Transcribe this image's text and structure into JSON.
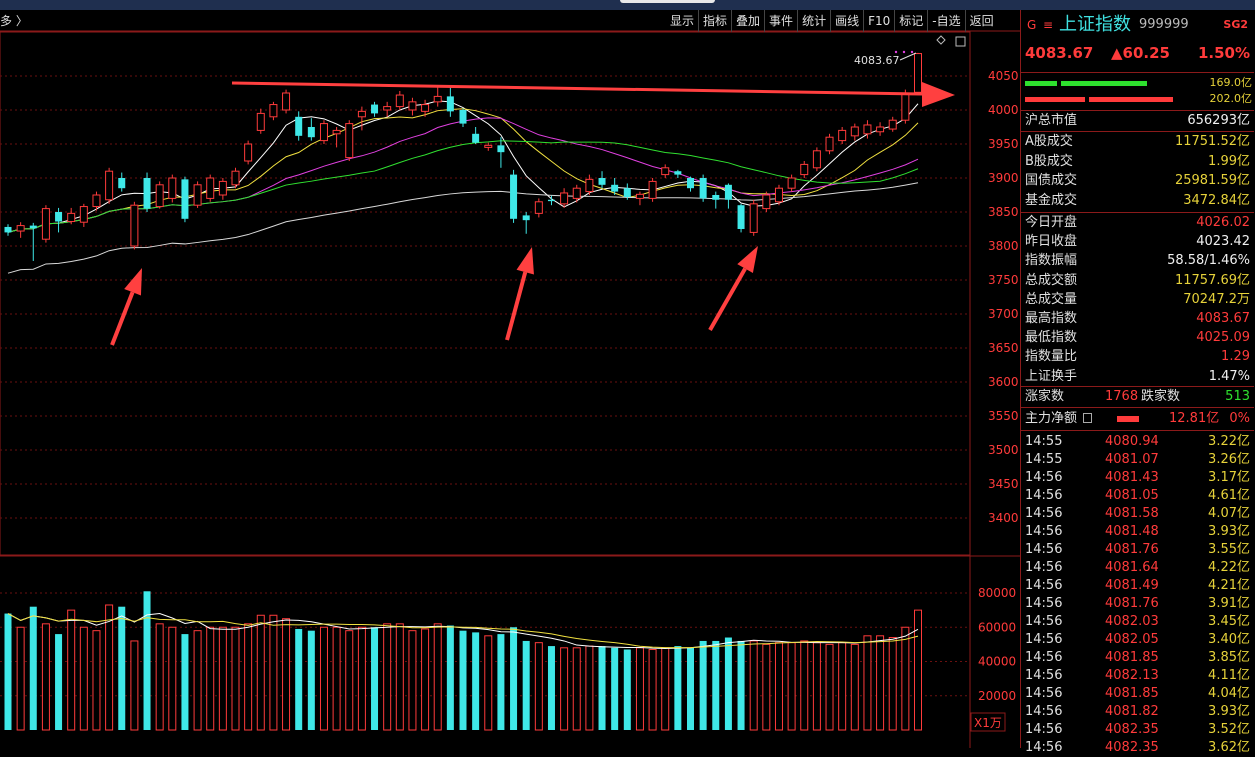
{
  "crumb": "多 〉",
  "toolbar": [
    "显示",
    "指标",
    "叠加",
    "事件",
    "统计",
    "画线",
    "F10",
    "标记",
    "-自选",
    "返回"
  ],
  "chart_data": {
    "type": "candlestick",
    "price_axis": {
      "range": [
        3360,
        4090
      ],
      "ticks": [
        4050,
        4000,
        3950,
        3900,
        3850,
        3800,
        3750,
        3700,
        3650,
        3600,
        3550,
        3500,
        3450,
        3400
      ]
    },
    "volume_axis": {
      "range": [
        0,
        90000
      ],
      "ticks": [
        80000,
        60000,
        40000,
        20000
      ],
      "unit": "X1万"
    },
    "last_label": "4083.67",
    "candles": [
      {
        "o": 3828,
        "h": 3832,
        "l": 3815,
        "c": 3820
      },
      {
        "o": 3822,
        "h": 3835,
        "l": 3812,
        "c": 3830
      },
      {
        "o": 3830,
        "h": 3834,
        "l": 3778,
        "c": 3826
      },
      {
        "o": 3810,
        "h": 3860,
        "l": 3805,
        "c": 3855
      },
      {
        "o": 3850,
        "h": 3856,
        "l": 3820,
        "c": 3836
      },
      {
        "o": 3836,
        "h": 3856,
        "l": 3832,
        "c": 3848
      },
      {
        "o": 3835,
        "h": 3862,
        "l": 3828,
        "c": 3858
      },
      {
        "o": 3858,
        "h": 3880,
        "l": 3852,
        "c": 3875
      },
      {
        "o": 3868,
        "h": 3915,
        "l": 3862,
        "c": 3910
      },
      {
        "o": 3900,
        "h": 3908,
        "l": 3880,
        "c": 3885
      },
      {
        "o": 3800,
        "h": 3865,
        "l": 3795,
        "c": 3860
      },
      {
        "o": 3900,
        "h": 3908,
        "l": 3850,
        "c": 3855
      },
      {
        "o": 3858,
        "h": 3895,
        "l": 3855,
        "c": 3890
      },
      {
        "o": 3870,
        "h": 3905,
        "l": 3864,
        "c": 3900
      },
      {
        "o": 3898,
        "h": 3902,
        "l": 3835,
        "c": 3840
      },
      {
        "o": 3860,
        "h": 3895,
        "l": 3856,
        "c": 3890
      },
      {
        "o": 3870,
        "h": 3905,
        "l": 3865,
        "c": 3900
      },
      {
        "o": 3875,
        "h": 3900,
        "l": 3868,
        "c": 3895
      },
      {
        "o": 3890,
        "h": 3915,
        "l": 3885,
        "c": 3910
      },
      {
        "o": 3925,
        "h": 3955,
        "l": 3920,
        "c": 3950
      },
      {
        "o": 3970,
        "h": 4002,
        "l": 3965,
        "c": 3995
      },
      {
        "o": 3990,
        "h": 4012,
        "l": 3985,
        "c": 4008
      },
      {
        "o": 4000,
        "h": 4030,
        "l": 3995,
        "c": 4025
      },
      {
        "o": 3990,
        "h": 3998,
        "l": 3955,
        "c": 3962
      },
      {
        "o": 3975,
        "h": 3988,
        "l": 3955,
        "c": 3960
      },
      {
        "o": 3955,
        "h": 3985,
        "l": 3950,
        "c": 3980
      },
      {
        "o": 3965,
        "h": 3975,
        "l": 3945,
        "c": 3970
      },
      {
        "o": 3930,
        "h": 3985,
        "l": 3925,
        "c": 3980
      },
      {
        "o": 3990,
        "h": 4005,
        "l": 3970,
        "c": 3998
      },
      {
        "o": 4008,
        "h": 4012,
        "l": 3990,
        "c": 3995
      },
      {
        "o": 4000,
        "h": 4012,
        "l": 3990,
        "c": 4005
      },
      {
        "o": 4005,
        "h": 4028,
        "l": 4000,
        "c": 4022
      },
      {
        "o": 4000,
        "h": 4018,
        "l": 3992,
        "c": 4012
      },
      {
        "o": 3998,
        "h": 4015,
        "l": 3990,
        "c": 4008
      },
      {
        "o": 4012,
        "h": 4035,
        "l": 4005,
        "c": 4020
      },
      {
        "o": 4020,
        "h": 4035,
        "l": 3990,
        "c": 3998
      },
      {
        "o": 4000,
        "h": 4002,
        "l": 3975,
        "c": 3980
      },
      {
        "o": 3965,
        "h": 3975,
        "l": 3950,
        "c": 3952
      },
      {
        "o": 3945,
        "h": 3952,
        "l": 3940,
        "c": 3948
      },
      {
        "o": 3948,
        "h": 3960,
        "l": 3915,
        "c": 3938
      },
      {
        "o": 3905,
        "h": 3912,
        "l": 3834,
        "c": 3840
      },
      {
        "o": 3845,
        "h": 3850,
        "l": 3818,
        "c": 3838
      },
      {
        "o": 3848,
        "h": 3870,
        "l": 3842,
        "c": 3865
      },
      {
        "o": 3868,
        "h": 3874,
        "l": 3860,
        "c": 3866
      },
      {
        "o": 3862,
        "h": 3885,
        "l": 3856,
        "c": 3878
      },
      {
        "o": 3870,
        "h": 3890,
        "l": 3864,
        "c": 3885
      },
      {
        "o": 3880,
        "h": 3905,
        "l": 3875,
        "c": 3898
      },
      {
        "o": 3900,
        "h": 3910,
        "l": 3885,
        "c": 3890
      },
      {
        "o": 3890,
        "h": 3900,
        "l": 3875,
        "c": 3880
      },
      {
        "o": 3885,
        "h": 3892,
        "l": 3868,
        "c": 3872
      },
      {
        "o": 3870,
        "h": 3880,
        "l": 3860,
        "c": 3876
      },
      {
        "o": 3870,
        "h": 3900,
        "l": 3865,
        "c": 3895
      },
      {
        "o": 3905,
        "h": 3920,
        "l": 3900,
        "c": 3915
      },
      {
        "o": 3910,
        "h": 3912,
        "l": 3900,
        "c": 3905
      },
      {
        "o": 3900,
        "h": 3902,
        "l": 3880,
        "c": 3885
      },
      {
        "o": 3900,
        "h": 3905,
        "l": 3865,
        "c": 3870
      },
      {
        "o": 3875,
        "h": 3880,
        "l": 3855,
        "c": 3868
      },
      {
        "o": 3890,
        "h": 3892,
        "l": 3855,
        "c": 3868
      },
      {
        "o": 3860,
        "h": 3862,
        "l": 3820,
        "c": 3825
      },
      {
        "o": 3820,
        "h": 3868,
        "l": 3815,
        "c": 3862
      },
      {
        "o": 3855,
        "h": 3880,
        "l": 3850,
        "c": 3875
      },
      {
        "o": 3865,
        "h": 3890,
        "l": 3860,
        "c": 3885
      },
      {
        "o": 3885,
        "h": 3905,
        "l": 3880,
        "c": 3900
      },
      {
        "o": 3905,
        "h": 3925,
        "l": 3900,
        "c": 3920
      },
      {
        "o": 3915,
        "h": 3945,
        "l": 3910,
        "c": 3940
      },
      {
        "o": 3940,
        "h": 3965,
        "l": 3935,
        "c": 3960
      },
      {
        "o": 3955,
        "h": 3975,
        "l": 3950,
        "c": 3970
      },
      {
        "o": 3962,
        "h": 3980,
        "l": 3955,
        "c": 3975
      },
      {
        "o": 3965,
        "h": 3985,
        "l": 3958,
        "c": 3978
      },
      {
        "o": 3968,
        "h": 3982,
        "l": 3962,
        "c": 3975
      },
      {
        "o": 3972,
        "h": 3990,
        "l": 3968,
        "c": 3985
      },
      {
        "o": 3985,
        "h": 4030,
        "l": 3980,
        "c": 4025
      },
      {
        "o": 4026,
        "h": 4084,
        "l": 4025,
        "c": 4083
      }
    ],
    "volumes": [
      68000,
      60000,
      72000,
      62000,
      56000,
      70000,
      60000,
      58000,
      73000,
      72000,
      52000,
      81000,
      62000,
      60000,
      56000,
      58000,
      60000,
      60000,
      60000,
      62000,
      67000,
      67000,
      65000,
      59000,
      58000,
      60000,
      60000,
      58000,
      60000,
      60000,
      62000,
      62000,
      58000,
      59000,
      62000,
      61000,
      58000,
      57000,
      55000,
      56000,
      60000,
      52000,
      51000,
      49000,
      48000,
      48000,
      49000,
      49000,
      48000,
      47000,
      48000,
      47000,
      48000,
      49000,
      48000,
      52000,
      52000,
      54000,
      52000,
      52000,
      50000,
      51000,
      51000,
      52000,
      51000,
      50000,
      51000,
      50000,
      55000,
      55000,
      54000,
      60000,
      70000
    ]
  },
  "sidebar": {
    "g": "G",
    "menu": "≡",
    "name": "上证指数",
    "code": "999999",
    "sg": "SG2",
    "price": "4083.67",
    "change": "▲60.25",
    "pct": "1.50%",
    "bar1": "169.0亿",
    "bar2": "202.0亿",
    "market_cap_label": "沪总市值",
    "market_cap": "656293亿",
    "stats1": [
      {
        "label": "A股成交",
        "value": "11751.52亿"
      },
      {
        "label": "B股成交",
        "value": "1.99亿"
      },
      {
        "label": "国债成交",
        "value": "25981.59亿"
      },
      {
        "label": "基金成交",
        "value": "3472.84亿"
      }
    ],
    "stats2": [
      {
        "label": "今日开盘",
        "value": "4026.02",
        "color": "red"
      },
      {
        "label": "昨日收盘",
        "value": "4023.42",
        "color": "wht"
      },
      {
        "label": "指数振幅",
        "value": "58.58/1.46%",
        "color": "wht"
      },
      {
        "label": "总成交额",
        "value": "11757.69亿",
        "color": "yel"
      },
      {
        "label": "总成交量",
        "value": "70247.2万",
        "color": "yel"
      },
      {
        "label": "最高指数",
        "value": "4083.67",
        "color": "red"
      },
      {
        "label": "最低指数",
        "value": "4025.09",
        "color": "red"
      },
      {
        "label": "指数量比",
        "value": "1.29",
        "color": "red"
      },
      {
        "label": "上证换手",
        "value": "1.47%",
        "color": "wht"
      }
    ],
    "rise_label": "涨家数",
    "rise": "1768",
    "fall_label": "跌家数",
    "fall": "513",
    "net_label": "主力净额",
    "net": "12.81亿",
    "net_pct": "0%",
    "ticks": [
      {
        "t": "14:55",
        "p": "4080.94",
        "v": "3.22亿"
      },
      {
        "t": "14:55",
        "p": "4081.07",
        "v": "3.26亿"
      },
      {
        "t": "14:56",
        "p": "4081.43",
        "v": "3.17亿"
      },
      {
        "t": "14:56",
        "p": "4081.05",
        "v": "4.61亿"
      },
      {
        "t": "14:56",
        "p": "4081.58",
        "v": "4.07亿"
      },
      {
        "t": "14:56",
        "p": "4081.48",
        "v": "3.93亿"
      },
      {
        "t": "14:56",
        "p": "4081.76",
        "v": "3.55亿"
      },
      {
        "t": "14:56",
        "p": "4081.64",
        "v": "4.22亿"
      },
      {
        "t": "14:56",
        "p": "4081.49",
        "v": "4.21亿"
      },
      {
        "t": "14:56",
        "p": "4081.76",
        "v": "3.91亿"
      },
      {
        "t": "14:56",
        "p": "4082.03",
        "v": "3.45亿"
      },
      {
        "t": "14:56",
        "p": "4082.05",
        "v": "3.40亿"
      },
      {
        "t": "14:56",
        "p": "4081.85",
        "v": "3.85亿"
      },
      {
        "t": "14:56",
        "p": "4082.13",
        "v": "4.11亿"
      },
      {
        "t": "14:56",
        "p": "4081.85",
        "v": "4.04亿"
      },
      {
        "t": "14:56",
        "p": "4081.82",
        "v": "3.93亿"
      },
      {
        "t": "14:56",
        "p": "4082.35",
        "v": "3.52亿"
      },
      {
        "t": "14:56",
        "p": "4082.35",
        "v": "3.62亿"
      }
    ]
  },
  "colors": {
    "up": "#ff3b3b",
    "down": "#3fe8e8",
    "ma5": "#ffffff",
    "ma10": "#f0e040",
    "ma20": "#e040e0",
    "ma30": "#30e030",
    "ma60": "#d8d8d8",
    "arrow": "#ff4040"
  }
}
